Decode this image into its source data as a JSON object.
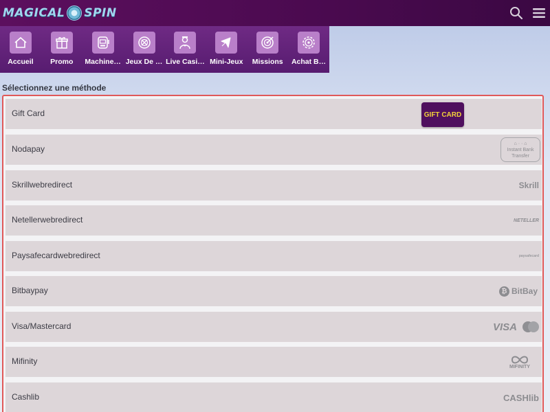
{
  "app": {
    "logo_left": "MAGICAL",
    "logo_right": "SPIN"
  },
  "icons": {
    "search": "search-icon",
    "menu": "hamburger-menu-icon"
  },
  "nav": {
    "items": [
      {
        "label": "Accueil",
        "icon": "home-icon"
      },
      {
        "label": "Promo",
        "icon": "gift-icon"
      },
      {
        "label": "Machine…",
        "icon": "slot-machine-icon"
      },
      {
        "label": "Jeux De …",
        "icon": "roulette-icon"
      },
      {
        "label": "Live Casi…",
        "icon": "dealer-icon"
      },
      {
        "label": "Mini-Jeux",
        "icon": "airplane-icon"
      },
      {
        "label": "Missions",
        "icon": "target-icon"
      },
      {
        "label": "Achat B…",
        "icon": "chip-icon"
      }
    ]
  },
  "page": {
    "section_title": "Sélectionnez une méthode"
  },
  "methods": [
    {
      "label": "Gift Card",
      "logo_text": "GIFT CARD"
    },
    {
      "label": "Nodapay",
      "logo_text": "Instant Bank Transfer"
    },
    {
      "label": "Skrillwebredirect",
      "logo_text": "Skrill"
    },
    {
      "label": "Netellerwebredirect",
      "logo_text": "NETELLER"
    },
    {
      "label": "Paysafecardwebredirect",
      "logo_text": "paysafecard"
    },
    {
      "label": "Bitbaypay",
      "logo_text": "BitBay"
    },
    {
      "label": "Visa/Mastercard",
      "logo_text": "VISA"
    },
    {
      "label": "Mifinity",
      "logo_text": "MIFINITY"
    },
    {
      "label": "Cashlib",
      "logo_text": "CASHlib"
    }
  ],
  "colors": {
    "topbar": "#5c0f5e",
    "navbar": "#6f2a84",
    "nav_icon_bg": "#b97fc9",
    "highlight_border": "#e05858",
    "method_bg": "#ddd6d9",
    "giftcard_bg": "#4f0f5e",
    "giftcard_text": "#f4d23a"
  }
}
